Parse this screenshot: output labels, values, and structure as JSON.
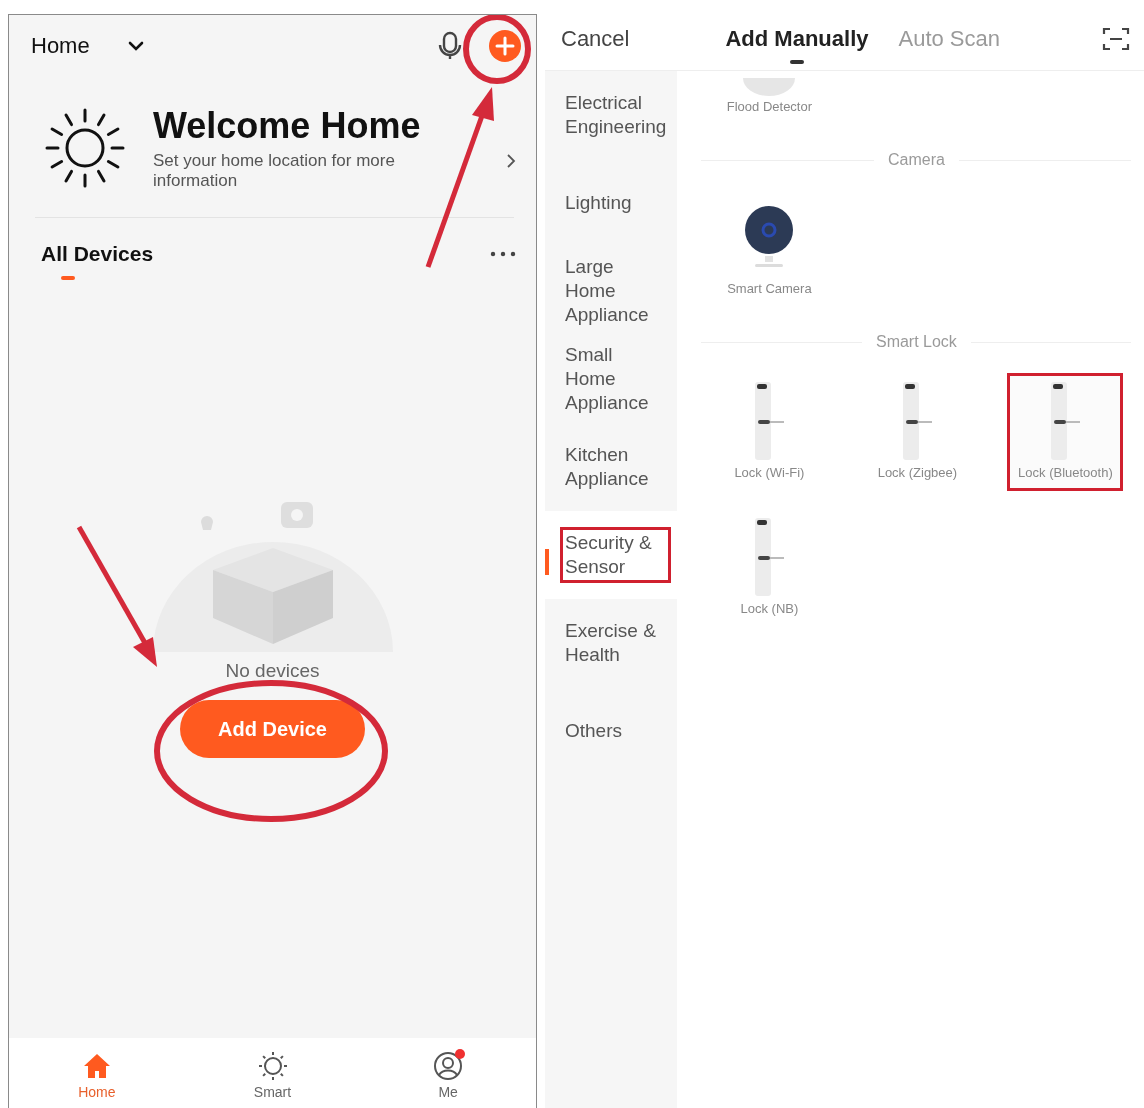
{
  "home": {
    "title": "Home",
    "welcome": {
      "title": "Welcome Home",
      "subtitle": "Set your home location for more information"
    },
    "section_title": "All Devices",
    "empty": {
      "message": "No devices",
      "button": "Add Device"
    },
    "nav": [
      {
        "label": "Home",
        "kind": "home",
        "selected": true,
        "badge": false
      },
      {
        "label": "Smart",
        "kind": "smart",
        "selected": false,
        "badge": false
      },
      {
        "label": "Me",
        "kind": "me",
        "selected": false,
        "badge": true
      }
    ]
  },
  "add_device": {
    "cancel": "Cancel",
    "tabs": [
      {
        "label": "Add Manually",
        "selected": true
      },
      {
        "label": "Auto Scan",
        "selected": false
      }
    ],
    "categories": [
      {
        "label": "Electrical Engineering",
        "selected": false,
        "highlighted": false
      },
      {
        "label": "Lighting",
        "selected": false,
        "highlighted": false
      },
      {
        "label": "Large Home Appliance",
        "selected": false,
        "highlighted": false
      },
      {
        "label": "Small Home Appliance",
        "selected": false,
        "highlighted": false
      },
      {
        "label": "Kitchen Appliance",
        "selected": false,
        "highlighted": false
      },
      {
        "label": "Security & Sensor",
        "selected": true,
        "highlighted": true
      },
      {
        "label": "Exercise & Health",
        "selected": false,
        "highlighted": false
      },
      {
        "label": "Others",
        "selected": false,
        "highlighted": false
      }
    ],
    "sections": [
      {
        "items": [
          {
            "label": "Flood Detector",
            "kind": "sensor",
            "highlighted": false
          }
        ]
      },
      {
        "title": "Camera",
        "items": [
          {
            "label": "Smart Camera",
            "kind": "camera",
            "highlighted": false
          }
        ]
      },
      {
        "title": "Smart Lock",
        "items": [
          {
            "label": "Lock (Wi-Fi)",
            "kind": "lock",
            "highlighted": false
          },
          {
            "label": "Lock (Zigbee)",
            "kind": "lock",
            "highlighted": false
          },
          {
            "label": "Lock (Bluetooth)",
            "kind": "lock",
            "highlighted": true
          },
          {
            "label": "Lock (NB)",
            "kind": "lock",
            "highlighted": false
          }
        ]
      }
    ]
  }
}
